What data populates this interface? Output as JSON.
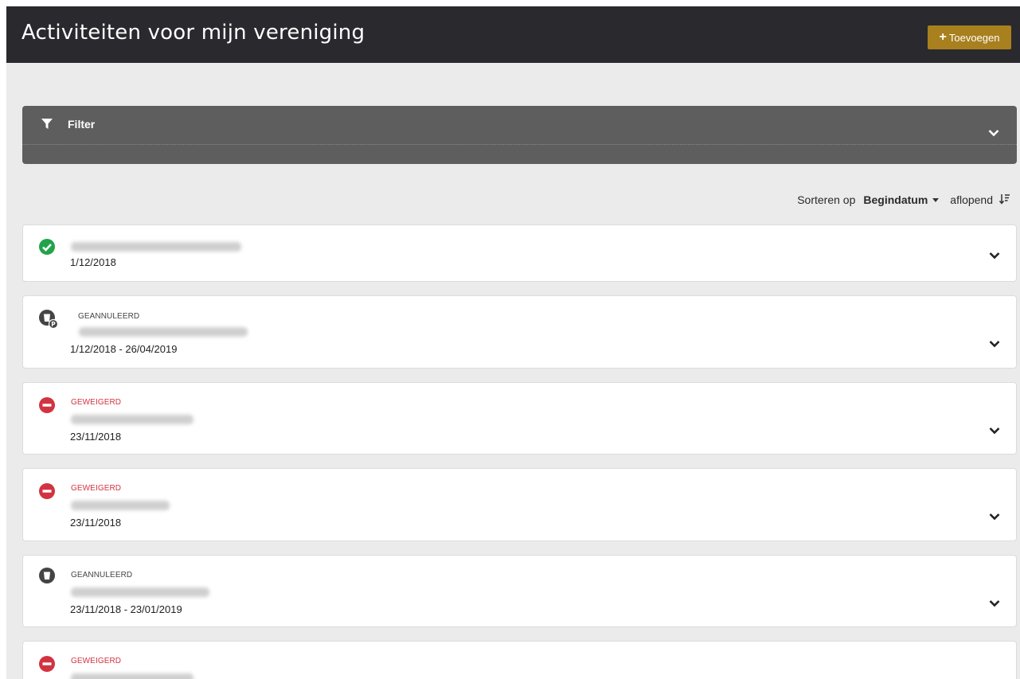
{
  "header": {
    "title": "Activiteiten voor mijn vereniging",
    "add_label": "Toevoegen",
    "accent": "#a8801e"
  },
  "filter": {
    "label": "Filter",
    "icon": "filter-icon"
  },
  "sort": {
    "label": "Sorteren op",
    "field": "Begindatum",
    "direction": "aflopend"
  },
  "activities": [
    {
      "status": "",
      "status_icon": "check-circle-icon",
      "date": "1/12/2018"
    },
    {
      "status": "GEANNULEERD",
      "status_icon": "cup-parking-icon",
      "date": "1/12/2018 - 26/04/2019"
    },
    {
      "status": "GEWEIGERD",
      "status_icon": "minus-circle-icon",
      "date": "23/11/2018"
    },
    {
      "status": "GEWEIGERD",
      "status_icon": "minus-circle-icon",
      "date": "23/11/2018"
    },
    {
      "status": "GEANNULEERD",
      "status_icon": "cup-icon",
      "date": "23/11/2018 - 23/01/2019"
    },
    {
      "status": "GEWEIGERD",
      "status_icon": "minus-circle-icon",
      "date": ""
    }
  ],
  "colors": {
    "approved": "#22a34a",
    "rejected": "#d23341",
    "cancelled": "#444444"
  }
}
